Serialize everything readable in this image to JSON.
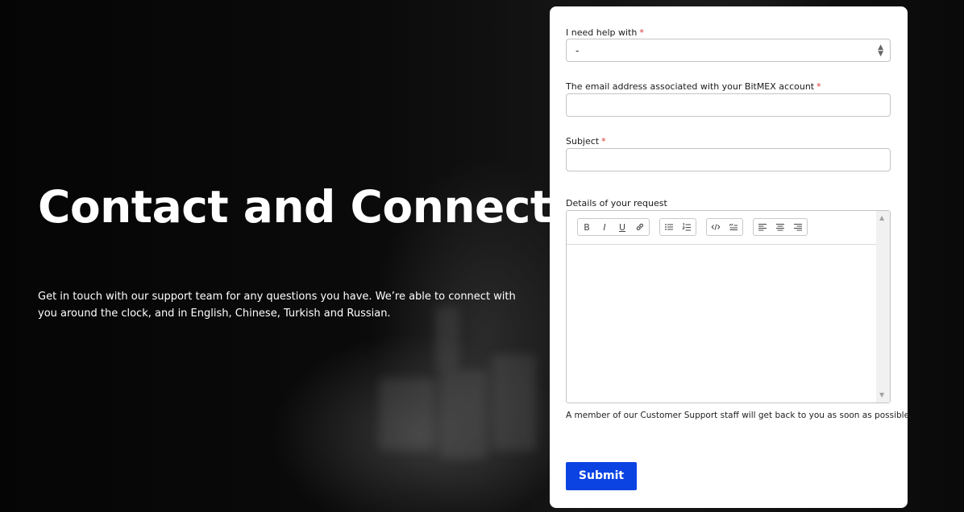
{
  "hero": {
    "title": "Contact and Connect",
    "description": "Get in touch with our support team for any questions you have. We’re able to connect with you around the clock, and in English, Chinese, Turkish and Russian."
  },
  "form": {
    "help_with": {
      "label": "I need help with",
      "required_mark": "*",
      "selected_value": "-"
    },
    "email": {
      "label": "The email address associated with your BitMEX account",
      "required_mark": "*",
      "value": ""
    },
    "subject": {
      "label": "Subject",
      "required_mark": "*",
      "value": ""
    },
    "details": {
      "label": "Details of your request",
      "value": "",
      "toolbar": {
        "bold": "B",
        "italic": "I",
        "underline": "U"
      }
    },
    "helper_text": "A member of our Customer Support staff will get back to you as soon as possible.",
    "submit_label": "Submit"
  },
  "colors": {
    "submit_bg": "#0b43e3",
    "required": "#d93636"
  }
}
